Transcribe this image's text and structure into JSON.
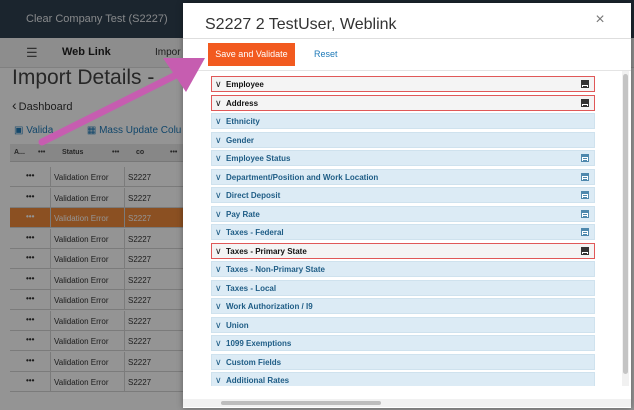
{
  "app": {
    "company_name": "Clear Company Test (S2227)",
    "nav": {
      "menu_icon": "hamburger-icon",
      "weblink": "Web Link",
      "import": "Impor"
    },
    "page_title": "Import Details -",
    "back_link": "Dashboard",
    "toolbar": {
      "validate": "Valida",
      "mass_update": "Mass Update Colu"
    },
    "table": {
      "headers": {
        "action": "A...",
        "status": "Status",
        "co": "co"
      },
      "rows": [
        {
          "dots": "•••",
          "status": "Validation Error",
          "co": "S2227",
          "selected": false
        },
        {
          "dots": "•••",
          "status": "Validation Error",
          "co": "S2227",
          "selected": false
        },
        {
          "dots": "•••",
          "status": "Validation Error",
          "co": "S2227",
          "selected": true
        },
        {
          "dots": "•••",
          "status": "Validation Error",
          "co": "S2227",
          "selected": false
        },
        {
          "dots": "•••",
          "status": "Validation Error",
          "co": "S2227",
          "selected": false
        },
        {
          "dots": "•••",
          "status": "Validation Error",
          "co": "S2227",
          "selected": false
        },
        {
          "dots": "•••",
          "status": "Validation Error",
          "co": "S2227",
          "selected": false
        },
        {
          "dots": "•••",
          "status": "Validation Error",
          "co": "S2227",
          "selected": false
        },
        {
          "dots": "•••",
          "status": "Validation Error",
          "co": "S2227",
          "selected": false
        },
        {
          "dots": "•••",
          "status": "Validation Error",
          "co": "S2227",
          "selected": false
        },
        {
          "dots": "•••",
          "status": "Validation Error",
          "co": "S2227",
          "selected": false
        }
      ]
    }
  },
  "modal": {
    "title": "S2227 2 TestUser, Weblink",
    "close_icon": "×",
    "save_label": "Save and Validate",
    "reset_label": "Reset",
    "sections": [
      {
        "label": "Employee",
        "error": true,
        "calendar": true
      },
      {
        "label": "Address",
        "error": true,
        "calendar": true
      },
      {
        "label": "Ethnicity",
        "error": false,
        "calendar": false
      },
      {
        "label": "Gender",
        "error": false,
        "calendar": false
      },
      {
        "label": "Employee Status",
        "error": false,
        "calendar": true
      },
      {
        "label": "Department/Position and Work Location",
        "error": false,
        "calendar": true
      },
      {
        "label": "Direct Deposit",
        "error": false,
        "calendar": true
      },
      {
        "label": "Pay Rate",
        "error": false,
        "calendar": true
      },
      {
        "label": "Taxes - Federal",
        "error": false,
        "calendar": true
      },
      {
        "label": "Taxes - Primary State",
        "error": true,
        "calendar": true
      },
      {
        "label": "Taxes - Non-Primary State",
        "error": false,
        "calendar": false
      },
      {
        "label": "Taxes - Local",
        "error": false,
        "calendar": false
      },
      {
        "label": "Work Authorization / I9",
        "error": false,
        "calendar": false
      },
      {
        "label": "Union",
        "error": false,
        "calendar": false
      },
      {
        "label": "1099 Exemptions",
        "error": false,
        "calendar": false
      },
      {
        "label": "Custom Fields",
        "error": false,
        "calendar": false
      },
      {
        "label": "Additional Rates",
        "error": false,
        "calendar": false
      }
    ]
  },
  "colors": {
    "topbar": "#2f4050",
    "accent_orange": "#f25a1f",
    "selected_row": "#f08a3c",
    "section_bg": "#dcebf5",
    "error_border": "#e05858",
    "arrow": "#c65db0"
  }
}
